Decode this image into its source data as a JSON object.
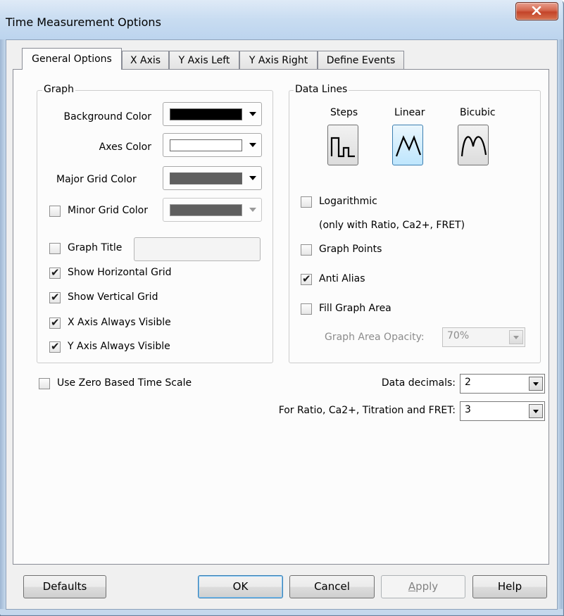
{
  "window": {
    "title": "Time Measurement Options",
    "close_glyph": "close-icon"
  },
  "tabs": [
    {
      "label": "General Options",
      "active": true
    },
    {
      "label": "X Axis",
      "active": false
    },
    {
      "label": "Y Axis Left",
      "active": false
    },
    {
      "label": "Y Axis Right",
      "active": false
    },
    {
      "label": "Define Events",
      "active": false
    }
  ],
  "graph": {
    "group_label": "Graph",
    "background_color_label": "Background Color",
    "background_color": "#000000",
    "axes_color_label": "Axes Color",
    "axes_color": "#ffffff",
    "major_grid_color_label": "Major Grid Color",
    "major_grid_color": "#5f5f5f",
    "minor_grid_color_label": "Minor Grid Color",
    "minor_grid_color": "#5f5f5f",
    "minor_grid_checked": false,
    "graph_title_label": "Graph Title",
    "graph_title_checked": false,
    "graph_title_value": "",
    "show_horizontal_grid_label": "Show Horizontal Grid",
    "show_horizontal_grid_checked": true,
    "show_vertical_grid_label": "Show Vertical Grid",
    "show_vertical_grid_checked": true,
    "x_axis_visible_label": "X Axis Always Visible",
    "x_axis_visible_checked": true,
    "y_axis_visible_label": "Y Axis Always Visible",
    "y_axis_visible_checked": true
  },
  "data_lines": {
    "group_label": "Data Lines",
    "steps_label": "Steps",
    "linear_label": "Linear",
    "bicubic_label": "Bicubic",
    "selected_style": "Linear",
    "logarithmic_label": "Logarithmic",
    "logarithmic_checked": false,
    "logarithmic_note": "(only with Ratio, Ca2+, FRET)",
    "graph_points_label": "Graph Points",
    "graph_points_checked": false,
    "anti_alias_label": "Anti Alias",
    "anti_alias_checked": true,
    "fill_graph_area_label": "Fill Graph Area",
    "fill_graph_area_checked": false,
    "opacity_label": "Graph Area Opacity:",
    "opacity_value": "70%"
  },
  "zero_based_label": "Use Zero Based Time Scale",
  "zero_based_checked": false,
  "data_decimals_label": "Data decimals:",
  "data_decimals_value": "2",
  "ratio_decimals_label": "For Ratio, Ca2+, Titration and FRET:",
  "ratio_decimals_value": "3",
  "buttons": {
    "defaults": "Defaults",
    "ok": "OK",
    "cancel": "Cancel",
    "apply_prefix": "",
    "apply_mnemonic": "A",
    "apply_rest": "pply",
    "help": "Help"
  }
}
